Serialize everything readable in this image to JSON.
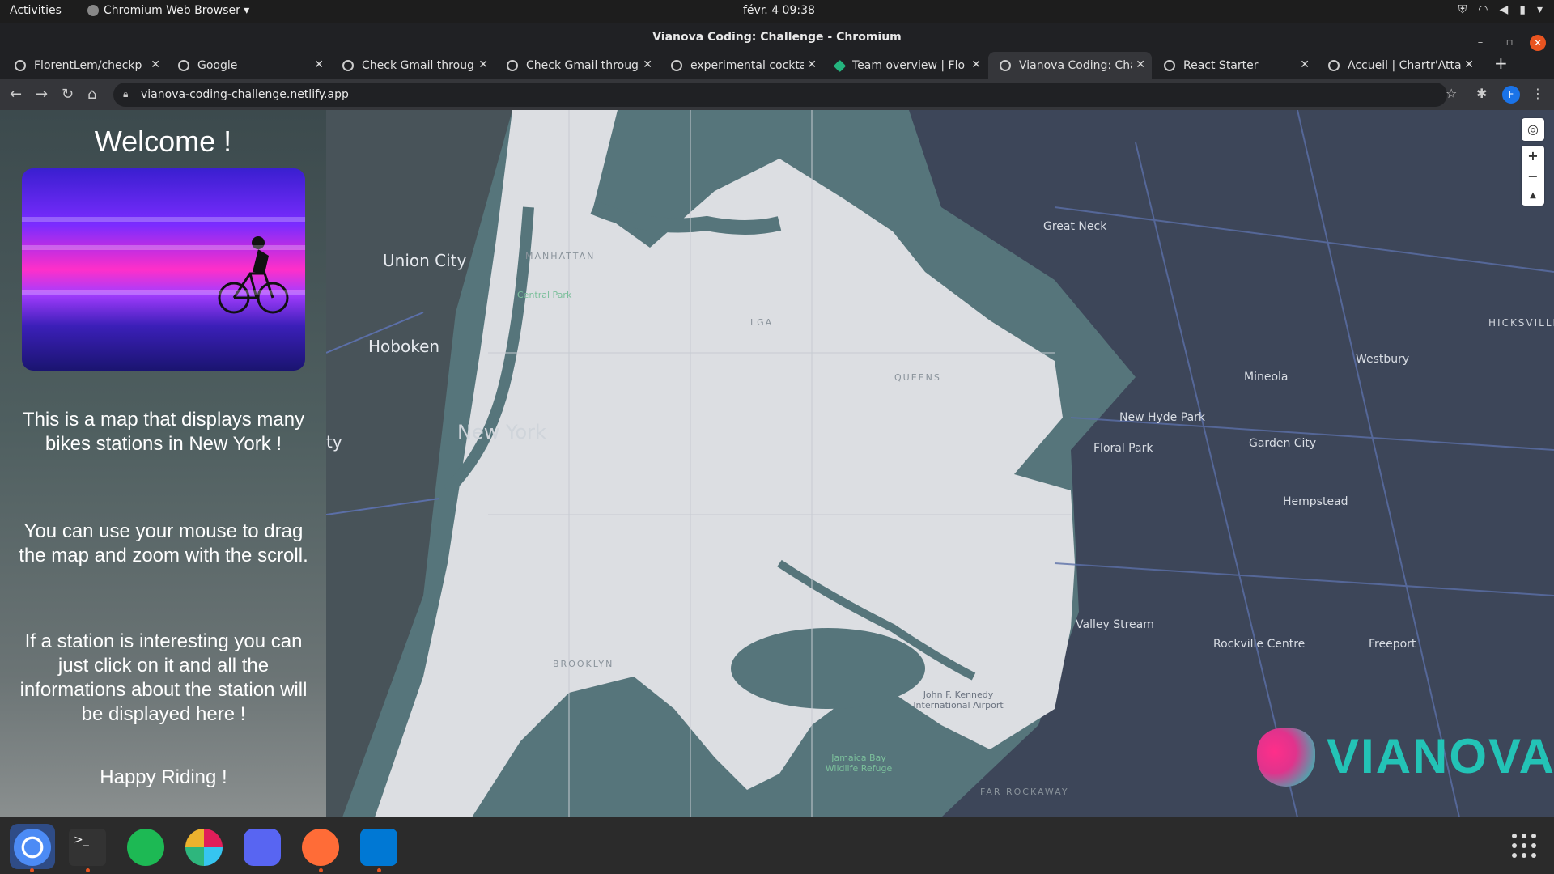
{
  "topbar": {
    "activities": "Activities",
    "app_name": "Chromium Web Browser ▾",
    "clock": "févr. 4  09:38"
  },
  "window": {
    "title": "Vianova Coding: Challenge - Chromium"
  },
  "tabs": [
    {
      "title": "FlorentLem/checkp",
      "icon": "github-icon"
    },
    {
      "title": "Google",
      "icon": "google-icon"
    },
    {
      "title": "Check Gmail throug",
      "icon": "google-icon"
    },
    {
      "title": "Check Gmail throug",
      "icon": "google-icon"
    },
    {
      "title": "experimental cockta",
      "icon": "google-icon"
    },
    {
      "title": "Team overview | Flor",
      "icon": "netlify-icon"
    },
    {
      "title": "Vianova Coding: Cha",
      "icon": "globe-icon",
      "active": true
    },
    {
      "title": "React Starter",
      "icon": "globe-icon"
    },
    {
      "title": "Accueil | Chartr'Atta",
      "icon": "globe-icon"
    }
  ],
  "address": {
    "url": "vianova-coding-challenge.netlify.app",
    "avatar": "F"
  },
  "sidebar": {
    "heading": "Welcome !",
    "p1": "This is a map that displays many bikes stations in New York !",
    "p2": "You can use your mouse to drag the map and zoom with the scroll.",
    "p3": "If a station is interesting you can just click on it and all the informations about the station will be displayed here !",
    "p4": "Happy Riding !"
  },
  "map": {
    "labels": {
      "union_city": "Union City",
      "hoboken": "Hoboken",
      "new_york": "New York",
      "manhattan": "MANHATTAN",
      "central_park": "Central Park",
      "lga": "LGA",
      "queens": "QUEENS",
      "brooklyn": "BROOKLYN",
      "great_neck": "Great Neck",
      "hicksville": "HICKSVILLE",
      "westbury": "Westbury",
      "mineola": "Mineola",
      "new_hyde_park": "New Hyde Park",
      "floral_park": "Floral Park",
      "garden_city": "Garden City",
      "hempstead": "Hempstead",
      "valley_stream": "Valley Stream",
      "rockville_centre": "Rockville Centre",
      "freeport": "Freeport",
      "jfk": "John F. Kennedy International Airport",
      "jamaica_bay": "Jamaica Bay Wildlife Refuge",
      "far_rockaway": "FAR ROCKAWAY",
      "ty": "ty"
    },
    "controls": {
      "zoom_in": "+",
      "zoom_out": "−",
      "north": "▲"
    },
    "logo_text": "VIANOVA",
    "colors": {
      "water": "#56757b",
      "land_highlight": "#dcdee2",
      "land_dark": "#3d4659",
      "roads": "#5b6fa8"
    }
  },
  "dock": {
    "apps": [
      "chromium-icon",
      "terminal-icon",
      "spotify-icon",
      "slack-icon",
      "discord-icon",
      "postman-icon",
      "vscode-icon"
    ],
    "terminal_glyph": ">_"
  }
}
